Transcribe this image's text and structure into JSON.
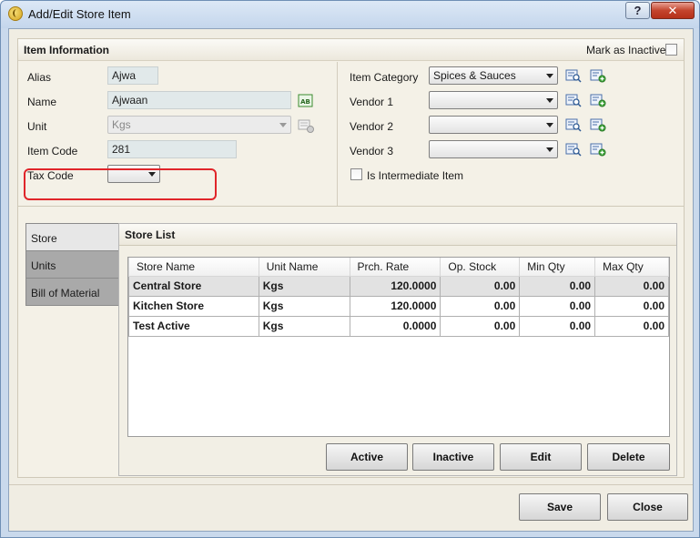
{
  "window": {
    "title": "Add/Edit Store Item",
    "help_glyph": "?",
    "close_glyph": "✕"
  },
  "item_info": {
    "title": "Item Information",
    "mark_inactive_label": "Mark as Inactive",
    "alias_label": "Alias",
    "alias_value": "Ajwa",
    "name_label": "Name",
    "name_value": "Ajwaan",
    "unit_label": "Unit",
    "unit_value": "Kgs",
    "item_code_label": "Item Code",
    "item_code_value": "281",
    "tax_code_label": "Tax Code",
    "tax_code_value": "",
    "item_category_label": "Item Category",
    "item_category_value": "Spices & Sauces",
    "vendor1_label": "Vendor 1",
    "vendor1_value": "",
    "vendor2_label": "Vendor 2",
    "vendor2_value": "",
    "vendor3_label": "Vendor 3",
    "vendor3_value": "",
    "intermediate_label": "Is Intermediate Item"
  },
  "tabs": [
    "Store",
    "Units",
    "Bill of Material"
  ],
  "store_list": {
    "title": "Store List",
    "columns": [
      "Store Name",
      "Unit Name",
      "Prch. Rate",
      "Op. Stock",
      "Min Qty",
      "Max Qty"
    ],
    "rows": [
      [
        "Central Store",
        "Kgs",
        "120.0000",
        "0.00",
        "0.00",
        "0.00"
      ],
      [
        "Kitchen Store",
        "Kgs",
        "120.0000",
        "0.00",
        "0.00",
        "0.00"
      ],
      [
        "Test Active",
        "Kgs",
        "0.0000",
        "0.00",
        "0.00",
        "0.00"
      ]
    ],
    "buttons": {
      "active": "Active",
      "inactive": "Inactive",
      "edit": "Edit",
      "delete": "Delete"
    }
  },
  "footer": {
    "save": "Save",
    "close": "Close"
  },
  "colors": {
    "highlight": "#e0252a",
    "title_bar": "#c4d6ec",
    "close_button": "#c4442d"
  }
}
